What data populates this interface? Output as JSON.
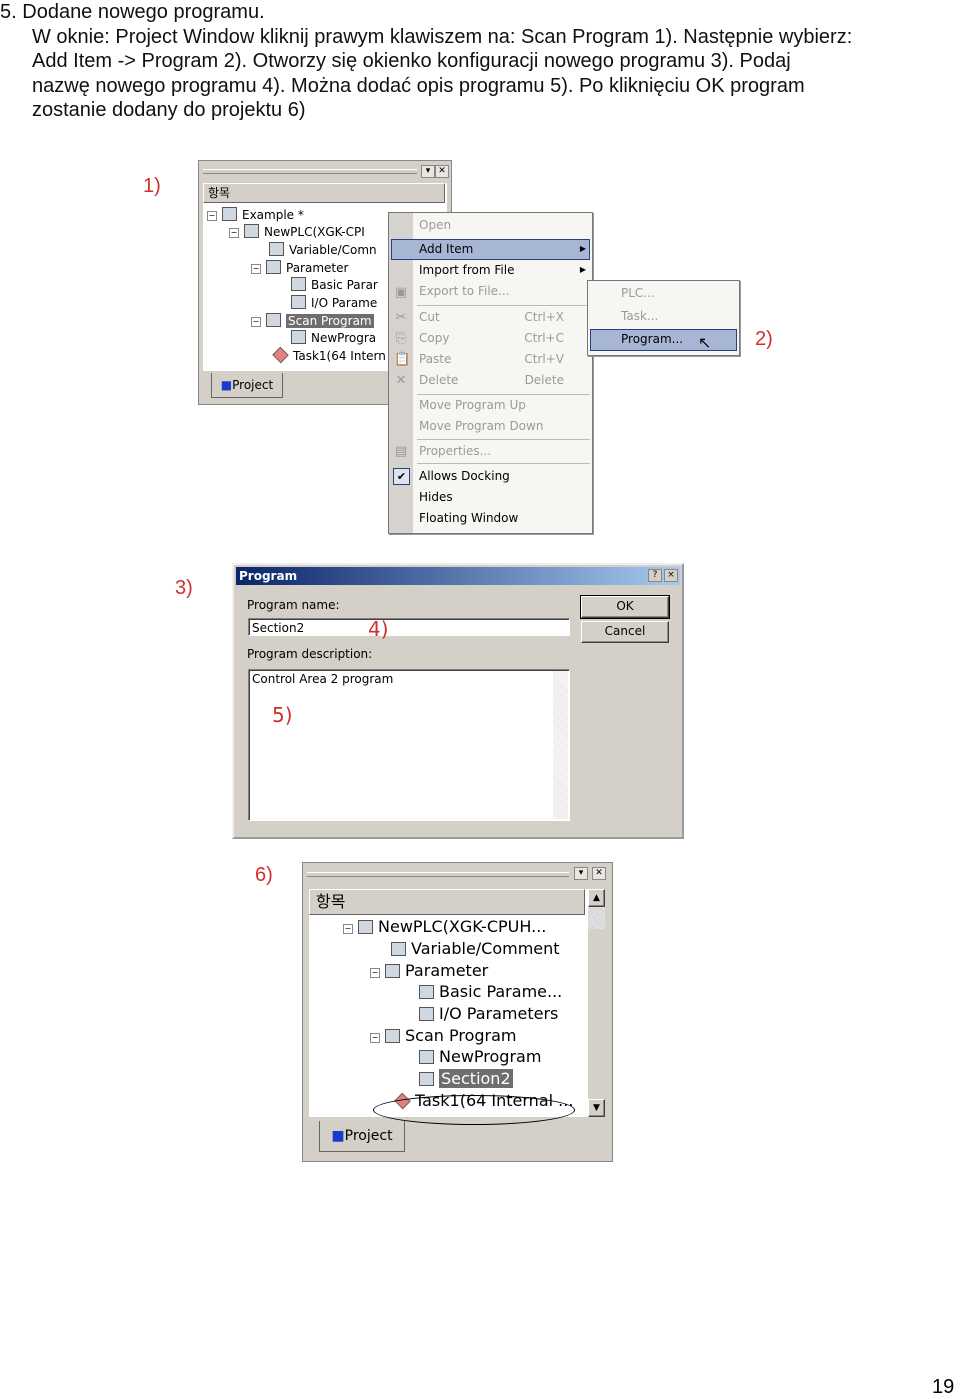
{
  "step": {
    "number": "5.",
    "title": "Dodane nowego programu.",
    "lines": [
      "W oknie: Project Window kliknij prawym klawiszem na: Scan Program 1). Następnie wybierz:",
      "Add Item -> Program 2). Otworzy się okienko konfiguracji nowego programu 3). Podaj",
      "nazwę nowego programu 4). Można dodać opis programu 5). Po kliknięciu OK program",
      "zostanie dodany do projektu 6)"
    ]
  },
  "labels": {
    "l1": "1)",
    "l2": "2)",
    "l3": "3)",
    "l4": "4)",
    "l5": "5)",
    "l6": "6)"
  },
  "shot1": {
    "header": "항목",
    "tree": [
      "Example *",
      "NewPLC(XGK-CPI",
      "Variable/Comn",
      "Parameter",
      "Basic Parar",
      "I/O Parame",
      "Scan Program",
      "NewProgra",
      "Task1(64 Intern"
    ],
    "tab": "Project"
  },
  "context_menu": {
    "items": [
      {
        "label": "Open",
        "disabled": true
      },
      {
        "label": "Add Item",
        "submenu": true,
        "highlighted": true
      },
      {
        "label": "Import from File",
        "submenu": true
      },
      {
        "label": "Export to File...",
        "disabled": true
      },
      {
        "label": "Cut",
        "shortcut": "Ctrl+X",
        "disabled": true
      },
      {
        "label": "Copy",
        "shortcut": "Ctrl+C",
        "disabled": true
      },
      {
        "label": "Paste",
        "shortcut": "Ctrl+V",
        "disabled": true
      },
      {
        "label": "Delete",
        "shortcut": "Delete",
        "disabled": true
      },
      {
        "label": "Move Program Up",
        "disabled": true
      },
      {
        "label": "Move Program Down",
        "disabled": true
      },
      {
        "label": "Properties...",
        "disabled": true
      },
      {
        "label": "Allows Docking",
        "checked": true
      },
      {
        "label": "Hides"
      },
      {
        "label": "Floating Window"
      }
    ]
  },
  "submenu": {
    "items": [
      {
        "label": "PLC...",
        "disabled": true
      },
      {
        "label": "Task...",
        "disabled": true
      },
      {
        "label": "Program...",
        "highlighted": true
      }
    ]
  },
  "dialog": {
    "title": "Program",
    "help": "?",
    "close": "×",
    "name_label": "Program name:",
    "name_value": "Section2",
    "desc_label": "Program description:",
    "desc_value": "Control Area 2 program",
    "ok": "OK",
    "cancel": "Cancel"
  },
  "shot6": {
    "header": "항목",
    "tree": [
      "NewPLC(XGK-CPUH...",
      "Variable/Comment",
      "Parameter",
      "Basic Parame...",
      "I/O Parameters",
      "Scan Program",
      "NewProgram",
      "Section2",
      "Task1(64 Internal ..."
    ],
    "tab": "Project"
  },
  "page_number": "19",
  "colors": {
    "label_red": "#d0312d",
    "menu_highlight": "#a8b6d6",
    "title_bar": "#0a246a"
  }
}
